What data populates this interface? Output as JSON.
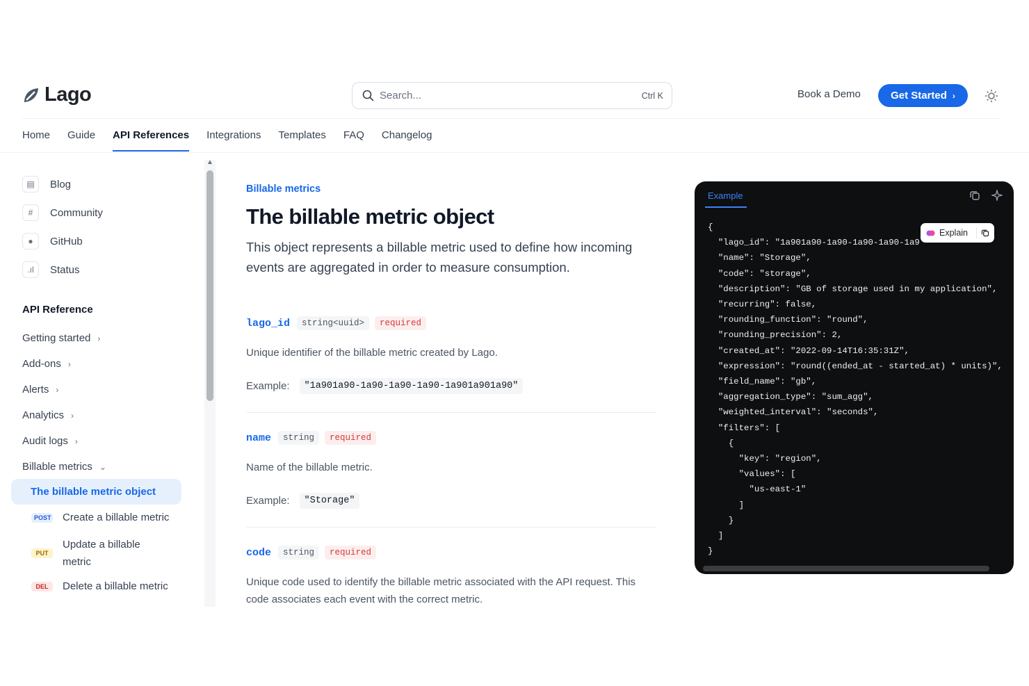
{
  "header": {
    "logo_text": "Lago",
    "search_placeholder": "Search...",
    "search_shortcut": "Ctrl K",
    "book_demo": "Book a Demo",
    "get_started": "Get Started"
  },
  "nav": [
    "Home",
    "Guide",
    "API References",
    "Integrations",
    "Templates",
    "FAQ",
    "Changelog"
  ],
  "nav_active": "API References",
  "sidebar": {
    "links": [
      {
        "label": "Blog",
        "icon": "newspaper-icon"
      },
      {
        "label": "Community",
        "icon": "slack-icon"
      },
      {
        "label": "GitHub",
        "icon": "github-icon"
      },
      {
        "label": "Status",
        "icon": "signal-bars-icon"
      }
    ],
    "section_title": "API Reference",
    "groups": [
      "Getting started",
      "Add-ons",
      "Alerts",
      "Analytics",
      "Audit logs",
      "Billable metrics"
    ],
    "active_item": "The billable metric object",
    "subitems": [
      {
        "method": "POST",
        "label": "Create a billable metric"
      },
      {
        "method": "PUT",
        "label": "Update a billable metric"
      },
      {
        "method": "DEL",
        "label": "Delete a billable metric"
      }
    ]
  },
  "main": {
    "breadcrumb": "Billable metrics",
    "title": "The billable metric object",
    "description": "This object represents a billable metric used to define how incoming events are aggregated in order to measure consumption.",
    "example_label": "Example:",
    "fields": [
      {
        "name": "lago_id",
        "type": "string<uuid>",
        "required": "required",
        "text": "Unique identifier of the billable metric created by Lago.",
        "example": "\"1a901a90-1a90-1a90-1a90-1a901a901a90\""
      },
      {
        "name": "name",
        "type": "string",
        "required": "required",
        "text": "Name of the billable metric.",
        "example": "\"Storage\""
      },
      {
        "name": "code",
        "type": "string",
        "required": "required",
        "text": "Unique code used to identify the billable metric associated with the API request. This code associates each event with the correct metric."
      }
    ]
  },
  "code_panel": {
    "tab": "Example",
    "explain": "Explain",
    "code": "{\n  \"lago_id\": \"1a901a90-1a90-1a90-1a90-1a9\n  \"name\": \"Storage\",\n  \"code\": \"storage\",\n  \"description\": \"GB of storage used in my application\",\n  \"recurring\": false,\n  \"rounding_function\": \"round\",\n  \"rounding_precision\": 2,\n  \"created_at\": \"2022-09-14T16:35:31Z\",\n  \"expression\": \"round((ended_at - started_at) * units)\",\n  \"field_name\": \"gb\",\n  \"aggregation_type\": \"sum_agg\",\n  \"weighted_interval\": \"seconds\",\n  \"filters\": [\n    {\n      \"key\": \"region\",\n      \"values\": [\n        \"us-east-1\"\n      ]\n    }\n  ]\n}"
  },
  "colors": {
    "accent": "#1868e8",
    "code_bg": "#0e0f11",
    "required": "#d33a3a"
  }
}
